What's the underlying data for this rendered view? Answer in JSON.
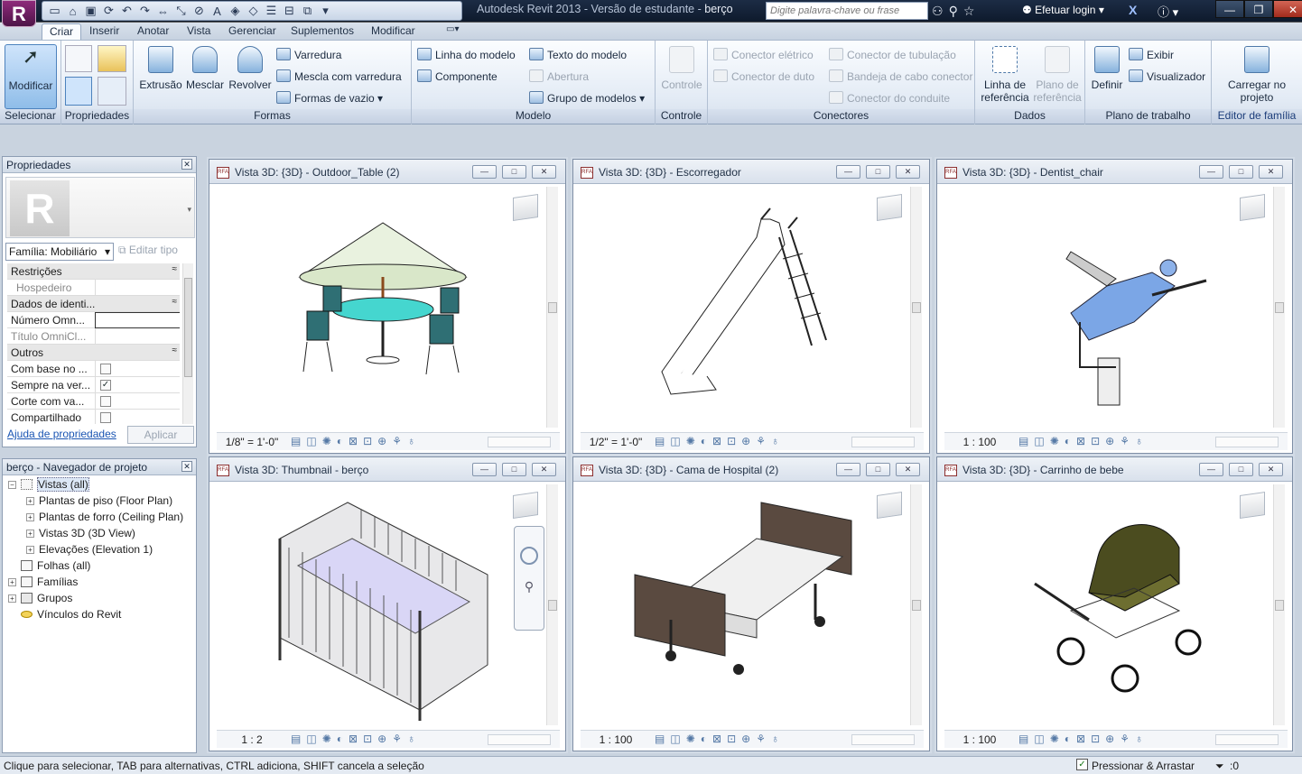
{
  "app": {
    "title": "Autodesk Revit 2013 - Versão de estudante -",
    "doc": "berço",
    "search_placeholder": "Digite palavra-chave ou frase",
    "login": "Efetuar login"
  },
  "tabs": [
    "Criar",
    "Inserir",
    "Anotar",
    "Vista",
    "Gerenciar",
    "Suplementos",
    "Modificar"
  ],
  "ribbon": {
    "selecionar": {
      "button": "Modificar",
      "label": "Selecionar"
    },
    "propriedades": {
      "label": "Propriedades"
    },
    "formas": {
      "extrusao": "Extrusão",
      "mesclar": "Mesclar",
      "revolver": "Revolver",
      "varredura": "Varredura",
      "mescla_varredura": "Mescla com varredura",
      "formas_vazio": "Formas de vazio",
      "label": "Formas"
    },
    "modelo": {
      "linha": "Linha do modelo",
      "componente": "Componente",
      "texto": "Texto do modelo",
      "abertura": "Abertura",
      "grupo": "Grupo de modelos",
      "label": "Modelo"
    },
    "controle": {
      "button": "Controle",
      "label": "Controle"
    },
    "conectores": {
      "eletrico": "Conector elétrico",
      "duto": "Conector de duto",
      "tubulacao": "Conector de tubulação",
      "bandeja": "Bandeja de cabo conector",
      "conduite": "Conector do conduite",
      "label": "Conectores"
    },
    "dados": {
      "linha_ref": "Linha de referência",
      "plano_ref": "Plano de referência",
      "label": "Dados"
    },
    "plano": {
      "definir": "Definir",
      "exibir": "Exibir",
      "visualizador": "Visualizador",
      "label": "Plano de trabalho"
    },
    "editor": {
      "carregar": "Carregar no projeto",
      "label": "Editor de família"
    }
  },
  "properties": {
    "title": "Propriedades",
    "family": "Família: Mobiliário",
    "edit_type": "Editar tipo",
    "cat_restricoes": "Restrições",
    "hospedeiro": "Hospedeiro",
    "cat_dados": "Dados de identi...",
    "numero": "Número Omn...",
    "titulo": "Título OmniCl...",
    "cat_outros": "Outros",
    "com_base": "Com base no ...",
    "sempre": "Sempre na ver...",
    "corte": "Corte com va...",
    "compartilhado": "Compartilhado",
    "help": "Ajuda de propriedades",
    "apply": "Aplicar"
  },
  "browser": {
    "title": "berço - Navegador de projeto",
    "items": [
      "Vistas (all)",
      "Plantas de piso (Floor Plan)",
      "Plantas de forro (Ceiling Plan)",
      "Vistas 3D (3D View)",
      "Elevações (Elevation 1)",
      "Folhas (all)",
      "Famílias",
      "Grupos",
      "Vínculos do Revit"
    ]
  },
  "views": [
    {
      "title": "Vista 3D: {3D} - Outdoor_Table (2)",
      "scale": "1/8\" = 1'-0\""
    },
    {
      "title": "Vista 3D: {3D} - Escorregador",
      "scale": "1/2\" = 1'-0\""
    },
    {
      "title": "Vista 3D: {3D} - Dentist_chair",
      "scale": "1 : 100"
    },
    {
      "title": "Vista 3D: Thumbnail - berço",
      "scale": "1 : 2"
    },
    {
      "title": "Vista 3D: {3D} - Cama de Hospital (2)",
      "scale": "1 : 100"
    },
    {
      "title": "Vista 3D: {3D} - Carrinho de bebe",
      "scale": "1 : 100"
    }
  ],
  "status": {
    "text": "Clique para selecionar, TAB para alternativas, CTRL adiciona, SHIFT cancela a seleção",
    "drag": "Pressionar & Arrastar",
    "filter": ":0"
  }
}
